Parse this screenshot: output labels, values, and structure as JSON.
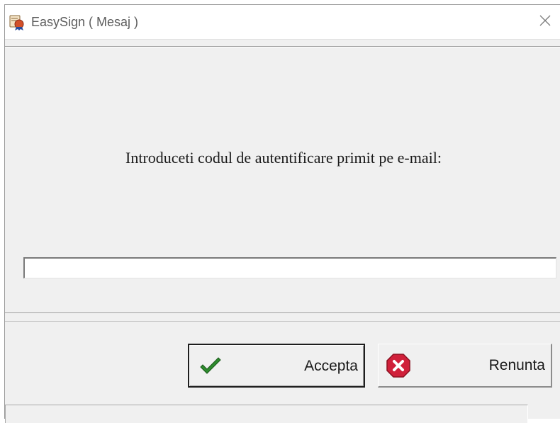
{
  "window": {
    "title": "EasySign ( Mesaj )",
    "icon": "certificate-icon",
    "close_icon": "close-icon"
  },
  "prompt": {
    "text": "Introduceti codul de autentificare primit pe e-mail:"
  },
  "code_input": {
    "value": "",
    "placeholder": ""
  },
  "buttons": {
    "accept_label": "Accepta",
    "accept_icon": "checkmark-icon",
    "cancel_label": "Renunta",
    "cancel_icon": "cancel-icon"
  },
  "status_bar": {
    "text": ""
  },
  "colors": {
    "accept_icon": "#2e8b2e",
    "cancel_icon": "#d0203a",
    "app_icon": "#d2502a"
  }
}
